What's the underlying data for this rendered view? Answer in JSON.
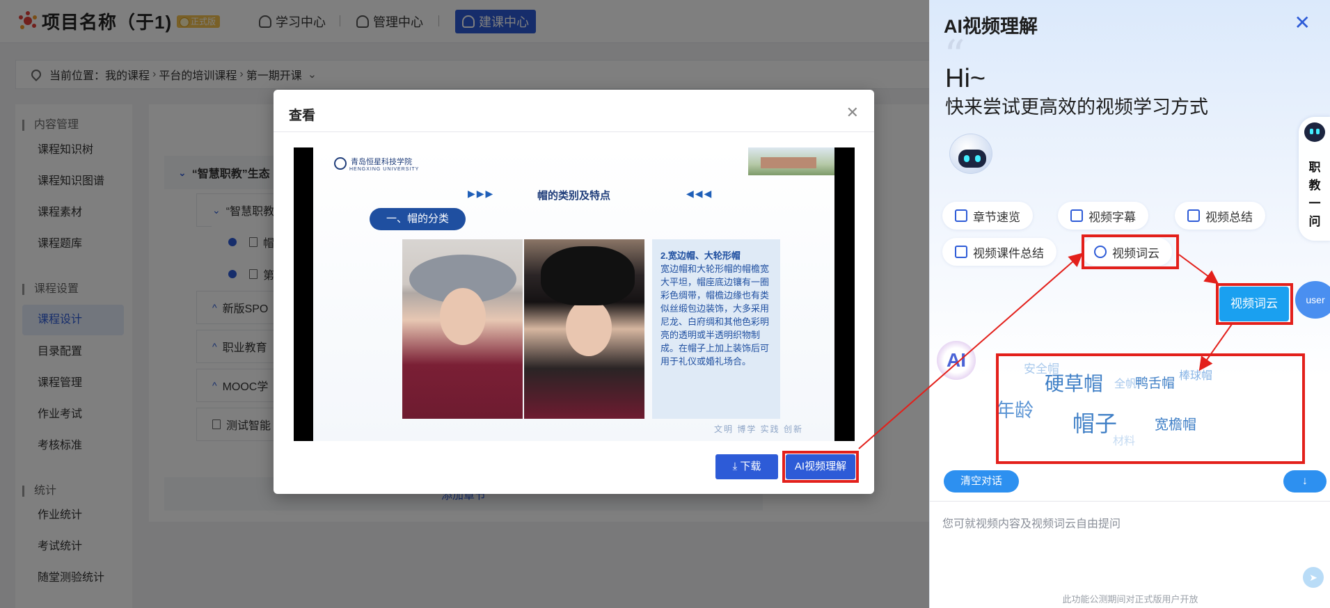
{
  "header": {
    "project_title": "项目名称（于1)",
    "badge": "正式版",
    "nav": [
      {
        "label": "学习中心"
      },
      {
        "label": "管理中心"
      },
      {
        "label": "建课中心"
      }
    ]
  },
  "breadcrumb": {
    "prefix": "当前位置：",
    "items": [
      "我的课程",
      "平台的培训课程",
      "第一期开课"
    ]
  },
  "sidebar": {
    "groups": [
      {
        "title": "内容管理",
        "items": [
          "课程知识树",
          "课程知识图谱",
          "课程素材",
          "课程题库"
        ]
      },
      {
        "title": "课程设置",
        "items": [
          "课程设计",
          "目录配置",
          "课程管理",
          "作业考试",
          "考核标准"
        ]
      },
      {
        "title": "统计",
        "items": [
          "作业统计",
          "考试统计",
          "随堂测验统计"
        ]
      }
    ],
    "active": "课程设计"
  },
  "tree": {
    "rows": [
      {
        "label": "“智慧职教”生态"
      },
      {
        "label": "“智慧职教"
      },
      {
        "label": "帽"
      },
      {
        "label": "第"
      },
      {
        "label": "新版SPO"
      },
      {
        "label": "职业教育"
      },
      {
        "label": "MOOC学"
      },
      {
        "label": "测试智能"
      }
    ],
    "add_chapter": "添加章节"
  },
  "modal": {
    "title": "查看",
    "slide": {
      "school_name": "青岛恒星科技学院",
      "school_en": "HENGXING  UNIVERSITY",
      "heading": "帽的类别及特点",
      "section_pill": "一、帽的分类",
      "text_title": "2.宽边帽、大轮形帽",
      "text_body": "宽边帽和大轮形帽的帽檐宽大平坦，帽座底边镶有一圈彩色绸带，帽檐边缘也有类似丝缎包边装饰，大多采用尼龙、白府绸和其他色彩明亮的透明或半透明织物制成。在帽子上加上装饰后可用于礼仪或婚礼场合。",
      "motto": "文明 博学 实践 创新"
    },
    "download_label": "下载",
    "ai_label": "AI视频理解"
  },
  "ai_panel": {
    "title": "AI视频理解",
    "greeting": "Hi~",
    "subtitle": "快来尝试更高效的视频学习方式",
    "chips": [
      "章节速览",
      "视频字幕",
      "视频总结",
      "视频课件总结",
      "视频词云"
    ],
    "user_message": "视频词云",
    "user_avatar": "user",
    "ai_avatar": "AI",
    "word_cloud": [
      {
        "text": "安全帽",
        "weight": 1
      },
      {
        "text": "硬草帽",
        "weight": 4
      },
      {
        "text": "全帆",
        "weight": 1
      },
      {
        "text": "鸭舌帽",
        "weight": 2
      },
      {
        "text": "棒球帽",
        "weight": 1
      },
      {
        "text": "年龄",
        "weight": 3
      },
      {
        "text": "帽子",
        "weight": 5
      },
      {
        "text": "宽檐帽",
        "weight": 2
      },
      {
        "text": "材料",
        "weight": 1
      }
    ],
    "side_assistant": "职教一问",
    "clear_label": "清空对话",
    "input_placeholder": "您可就视频内容及视频词云自由提问",
    "disclaimer": "此功能公测期间对正式版用户开放",
    "colors": {
      "accent": "#2d5bd7",
      "highlight": "#e3201b",
      "bubble": "#1aa0f0"
    }
  }
}
